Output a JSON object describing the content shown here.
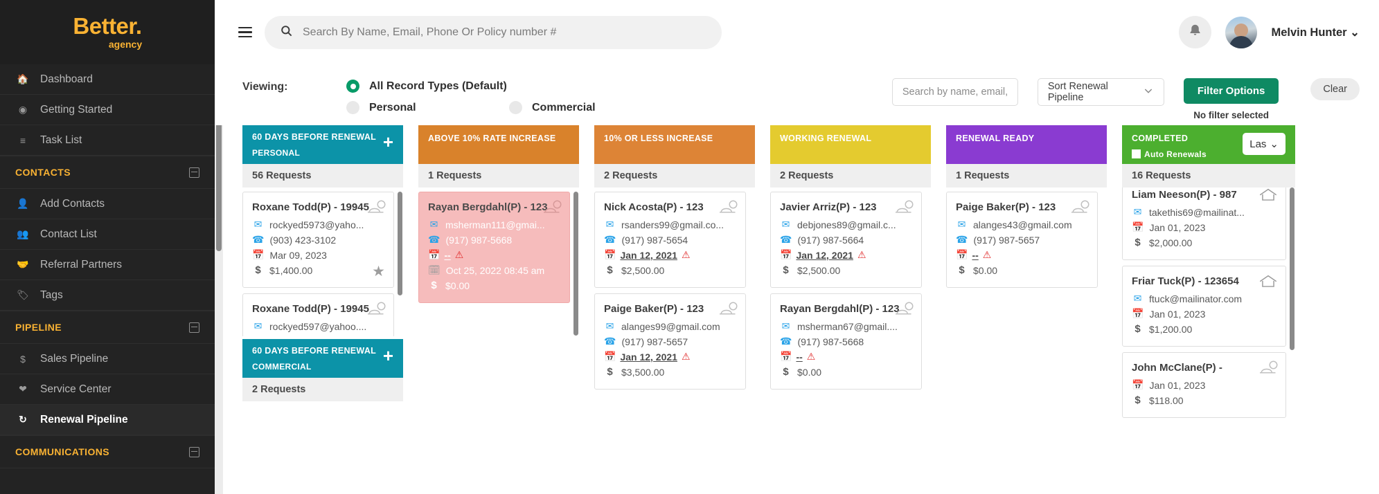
{
  "brand": {
    "main": "Better.",
    "sub": "agency"
  },
  "sidebar": {
    "items": [
      {
        "label": "Dashboard",
        "icon": "home-icon"
      },
      {
        "label": "Getting Started",
        "icon": "play-circle-icon"
      },
      {
        "label": "Task List",
        "icon": "task-list-icon"
      }
    ],
    "sections": [
      {
        "title": "CONTACTS",
        "items": [
          {
            "label": "Add Contacts",
            "icon": "user-plus-icon"
          },
          {
            "label": "Contact List",
            "icon": "users-icon"
          },
          {
            "label": "Referral Partners",
            "icon": "handshake-icon"
          },
          {
            "label": "Tags",
            "icon": "tag-icon"
          }
        ]
      },
      {
        "title": "PIPELINE",
        "items": [
          {
            "label": "Sales Pipeline",
            "icon": "dollar-icon"
          },
          {
            "label": "Service Center",
            "icon": "heart-icon"
          },
          {
            "label": "Renewal Pipeline",
            "icon": "refresh-icon",
            "active": true
          }
        ]
      },
      {
        "title": "COMMUNICATIONS",
        "items": []
      }
    ]
  },
  "header": {
    "search_placeholder": "Search By Name, Email, Phone Or Policy number #",
    "search_value": "",
    "user_name": "Melvin Hunter",
    "bell_icon": "bell-icon",
    "menu_icon": "hamburger-icon",
    "search_icon": "search-icon",
    "chevron_icon": "chevron-down-icon"
  },
  "filterbar": {
    "viewing_label": "Viewing:",
    "options": [
      {
        "label": "All Record Types (Default)",
        "checked": true
      },
      {
        "label": "Personal",
        "checked": false
      },
      {
        "label": "Commercial",
        "checked": false
      }
    ],
    "mini_search_placeholder": "Search by name, email, ph",
    "mini_search_value": "",
    "sort_label": "Sort Renewal Pipeline",
    "filter_button": "Filter Options",
    "no_filter_text": "No filter selected",
    "clear_button": "Clear",
    "accent_green": "#0f8a63"
  },
  "board": {
    "columns": [
      {
        "title": "60 DAYS BEFORE RENEWAL",
        "subtitle": "PERSONAL",
        "color": "#0c93a8",
        "count": "56 Requests",
        "has_plus": true,
        "cards": [
          {
            "title": "Roxane Todd(P) - 19945",
            "email": "rockyed5973@yaho...",
            "phone": "(903) 423-3102",
            "date": "Mar 09, 2023",
            "amount": "$1,400.00",
            "policy_icon": "auto-policy-icon",
            "starred": true
          },
          {
            "title": "Roxane Todd(P) - 19945",
            "email": "rockyed597@yahoo....",
            "policy_icon": "auto-policy-icon"
          }
        ]
      },
      {
        "title": "60 DAYS BEFORE RENEWAL",
        "subtitle": "COMMERCIAL",
        "color": "#0c93a8",
        "count": "2 Requests",
        "has_plus": true,
        "cards": []
      },
      {
        "title": "ABOVE 10% RATE INCREASE",
        "color": "#d9822b",
        "count": "1 Requests",
        "cards": [
          {
            "title": "Rayan Bergdahl(P) - 123",
            "email": "msherman111@gmai...",
            "phone": "(917) 987-5668",
            "date": "--",
            "warn": true,
            "date2": "Oct 25, 2022 08:45 am",
            "amount": "$0.00",
            "policy_icon": "auto-policy-icon",
            "highlight": true
          }
        ]
      },
      {
        "title": "10% OR LESS INCREASE",
        "color": "#dd8436",
        "count": "2 Requests",
        "cards": [
          {
            "title": "Nick Acosta(P) - 123",
            "email": "rsanders99@gmail.co...",
            "phone": "(917) 987-5654",
            "date": "Jan 12, 2021",
            "date_link": true,
            "warn": true,
            "amount": "$2,500.00",
            "policy_icon": "auto-policy-icon"
          },
          {
            "title": "Paige Baker(P) - 123",
            "email": "alanges99@gmail.com",
            "phone": "(917) 987-5657",
            "date": "Jan 12, 2021",
            "date_link": true,
            "warn": true,
            "amount": "$3,500.00",
            "policy_icon": "auto-policy-icon"
          }
        ]
      },
      {
        "title": "WORKING RENEWAL",
        "color": "#e4cb2f",
        "count": "2 Requests",
        "cards": [
          {
            "title": "Javier Arriz(P) - 123",
            "email": "debjones89@gmail.c...",
            "phone": "(917) 987-5664",
            "date": "Jan 12, 2021",
            "date_link": true,
            "warn": true,
            "amount": "$2,500.00",
            "policy_icon": "auto-policy-icon"
          },
          {
            "title": "Rayan Bergdahl(P) - 123",
            "email": "msherman67@gmail....",
            "phone": "(917) 987-5668",
            "date": "--",
            "date_link": true,
            "warn": true,
            "amount": "$0.00",
            "policy_icon": "auto-policy-icon"
          }
        ]
      },
      {
        "title": "RENEWAL READY",
        "color": "#8a3bd1",
        "count": "1 Requests",
        "cards": [
          {
            "title": "Paige Baker(P) - 123",
            "email": "alanges43@gmail.com",
            "phone": "(917) 987-5657",
            "date": "--",
            "date_link": true,
            "warn": true,
            "amount": "$0.00",
            "policy_icon": "auto-policy-icon"
          }
        ]
      },
      {
        "title": "COMPLETED",
        "color": "#4caf2f",
        "count": "16 Requests",
        "checkbox_label": "Auto Renewals",
        "dropdown_label": "Las",
        "cards": [
          {
            "title": "Liam Neeson(P) - 987",
            "email": "takethis69@mailinat...",
            "date": "Jan 01, 2023",
            "amount": "$2,000.00",
            "policy_icon": "home-policy-icon"
          },
          {
            "title": "Friar Tuck(P) - 123654",
            "email": "ftuck@mailinator.com",
            "date": "Jan 01, 2023",
            "amount": "$1,200.00",
            "policy_icon": "home-policy-icon"
          },
          {
            "title": "John McClane(P) - ",
            "date": "Jan 01, 2023",
            "amount": "$118.00",
            "policy_icon": "auto-policy-icon"
          }
        ]
      }
    ]
  }
}
